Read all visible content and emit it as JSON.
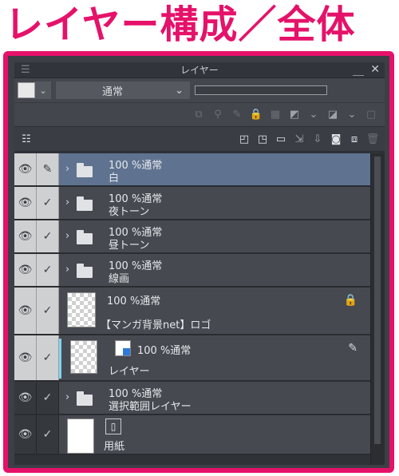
{
  "heading": "レイヤー構成／全体",
  "panel": {
    "title": "レイヤー",
    "blend_mode": "通常",
    "dropdown_arrow": "⌄"
  },
  "colors": {
    "accent": "#e5126a",
    "selected_row": "#5f7391",
    "sel_indicator": "#7fd4f0"
  },
  "layers": [
    {
      "mode": "100 %通常",
      "name": "白",
      "type": "folder",
      "selected": true,
      "edit_icon": "pen-icon"
    },
    {
      "mode": "100 %通常",
      "name": "夜トーン",
      "type": "folder"
    },
    {
      "mode": "100 %通常",
      "name": "昼トーン",
      "type": "folder"
    },
    {
      "mode": "100 %通常",
      "name": "線画",
      "type": "folder"
    },
    {
      "mode": "100 %通常",
      "name": "【マンガ背景net】ロゴ",
      "type": "raster",
      "locked": true
    },
    {
      "mode": "100 %通常",
      "name": "レイヤー",
      "type": "raster-with-mask",
      "active": true
    },
    {
      "mode": "100 %通常",
      "name": "選択範囲レイヤー",
      "type": "folder",
      "dark": true
    },
    {
      "mode": "",
      "name": "用紙",
      "type": "paper",
      "dark": true
    }
  ]
}
